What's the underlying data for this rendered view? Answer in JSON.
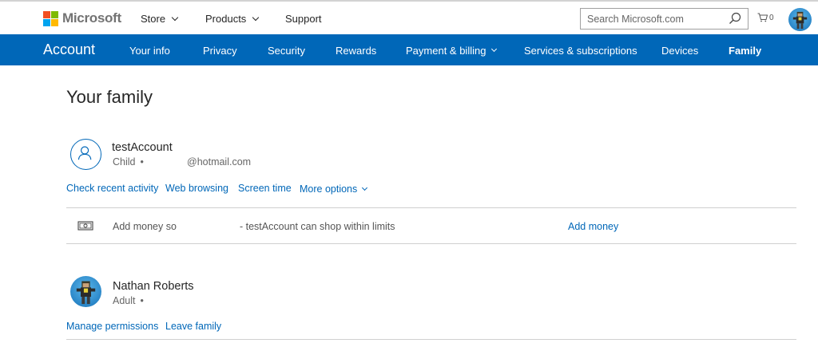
{
  "header": {
    "brand": "Microsoft",
    "nav": [
      {
        "label": "Store"
      },
      {
        "label": "Products"
      },
      {
        "label": "Support"
      }
    ],
    "search": {
      "placeholder": "Search Microsoft.com"
    },
    "cart_count": "0"
  },
  "account_nav": {
    "title": "Account",
    "items": [
      {
        "label": "Your info"
      },
      {
        "label": "Privacy"
      },
      {
        "label": "Security"
      },
      {
        "label": "Rewards"
      },
      {
        "label": "Payment & billing"
      },
      {
        "label": "Services & subscriptions"
      },
      {
        "label": "Devices"
      },
      {
        "label": "Family"
      }
    ]
  },
  "main": {
    "title": "Your family",
    "members": [
      {
        "name": "testAccount",
        "role": "Child",
        "dot": "•",
        "email": "@hotmail.com",
        "actions": [
          "Check recent activity",
          "Web browsing",
          "Screen time",
          "More options"
        ],
        "money": {
          "text_left": "Add money so",
          "text_right": "- testAccount can shop within limits",
          "action": "Add money"
        }
      },
      {
        "name": "Nathan Roberts",
        "role": "Adult",
        "dot": "•",
        "actions": [
          "Manage permissions",
          "Leave family"
        ]
      }
    ]
  },
  "colors": {
    "accent": "#0067b8",
    "nav_bg": "#0067b8"
  }
}
